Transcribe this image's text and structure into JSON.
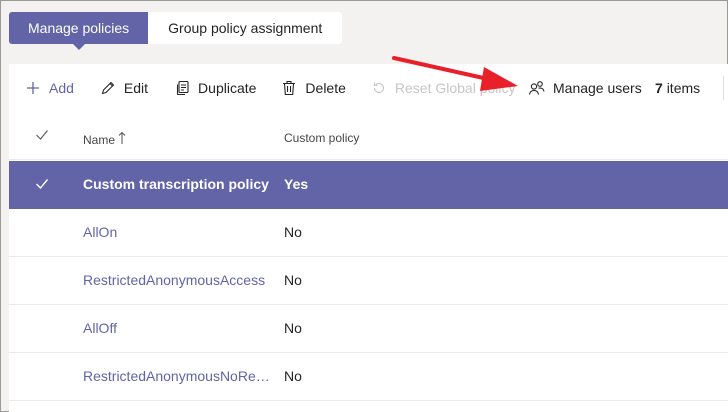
{
  "tabs": [
    {
      "label": "Manage policies",
      "active": true
    },
    {
      "label": "Group policy assignment",
      "active": false
    }
  ],
  "toolbar": {
    "add_label": "Add",
    "edit_label": "Edit",
    "duplicate_label": "Duplicate",
    "delete_label": "Delete",
    "reset_label": "Reset Global policy",
    "manage_users_label": "Manage users",
    "items_count": "7",
    "items_suffix": "items"
  },
  "table": {
    "headers": {
      "name": "Name",
      "custom": "Custom policy"
    },
    "rows": [
      {
        "name": "Custom transcription policy",
        "custom": "Yes",
        "selected": true
      },
      {
        "name": "AllOn",
        "custom": "No",
        "selected": false
      },
      {
        "name": "RestrictedAnonymousAccess",
        "custom": "No",
        "selected": false
      },
      {
        "name": "AllOff",
        "custom": "No",
        "selected": false
      },
      {
        "name": "RestrictedAnonymousNoRecording",
        "custom": "No",
        "selected": false
      }
    ]
  },
  "colors": {
    "accent": "#6264a7",
    "annotation_arrow": "#e8202a",
    "background": "#f3f2f1"
  }
}
